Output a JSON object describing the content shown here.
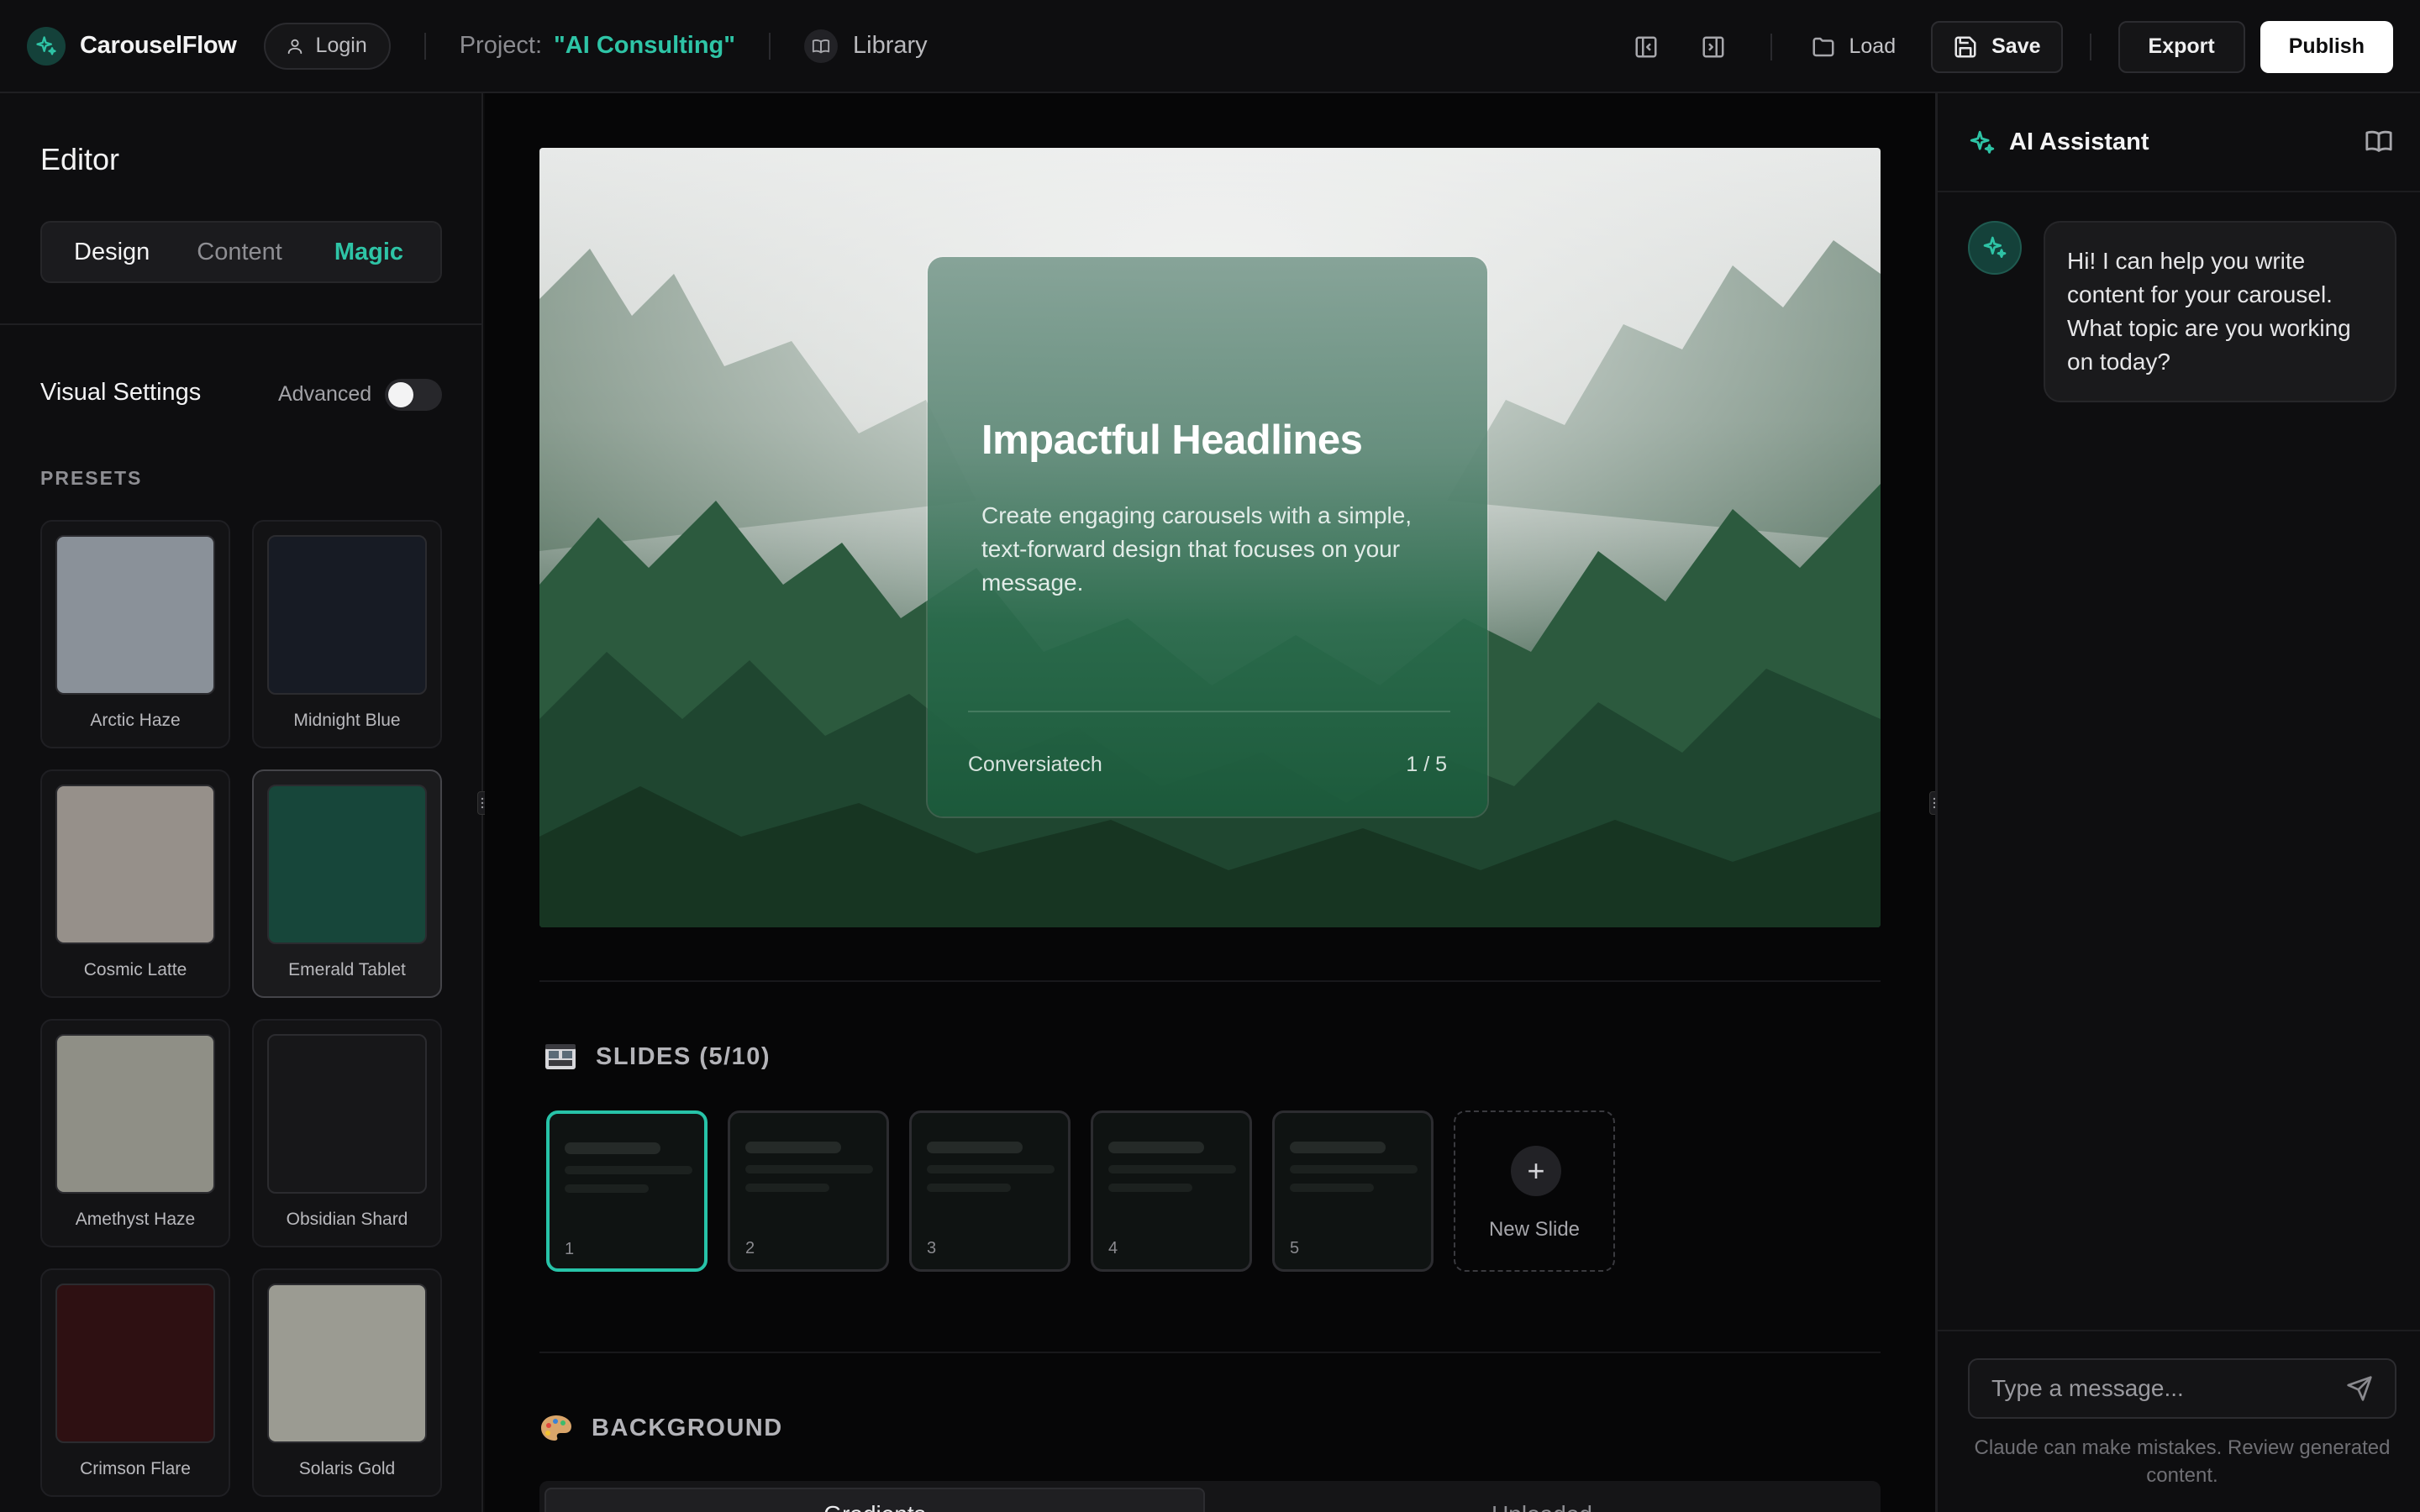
{
  "app": {
    "name": "CarouselFlow"
  },
  "topbar": {
    "login_label": "Login",
    "project_label": "Project:",
    "project_name": "\"AI Consulting\"",
    "library_label": "Library",
    "load_label": "Load",
    "save_label": "Save",
    "export_label": "Export",
    "publish_label": "Publish"
  },
  "editor": {
    "title": "Editor",
    "tabs": [
      {
        "label": "Design",
        "active": false
      },
      {
        "label": "Content",
        "active": false
      },
      {
        "label": "Magic",
        "active": true
      }
    ],
    "visual_settings_title": "Visual Settings",
    "advanced_label": "Advanced",
    "advanced_enabled": false,
    "presets_label": "PRESETS",
    "presets": [
      {
        "name": "Arctic Haze",
        "color": "#8a9199",
        "active": false
      },
      {
        "name": "Midnight Blue",
        "color": "#171b24",
        "active": false
      },
      {
        "name": "Cosmic Latte",
        "color": "#96908a",
        "active": false
      },
      {
        "name": "Emerald Tablet",
        "color": "#17463a",
        "active": true
      },
      {
        "name": "Amethyst Haze",
        "color": "#8f8f86",
        "active": false
      },
      {
        "name": "Obsidian Shard",
        "color": "#171719",
        "active": false
      },
      {
        "name": "Crimson Flare",
        "color": "#2e1012",
        "active": false
      },
      {
        "name": "Solaris Gold",
        "color": "#9b9b92",
        "active": false
      }
    ]
  },
  "slide": {
    "headline": "Impactful Headlines",
    "body": "Create engaging carousels with a simple, text-forward design that focuses on your message.",
    "brand": "Conversiatech",
    "page_indicator": "1 / 5"
  },
  "slides_section": {
    "title": "SLIDES (5/10)",
    "slides": [
      {
        "number": "1",
        "active": true
      },
      {
        "number": "2",
        "active": false
      },
      {
        "number": "3",
        "active": false
      },
      {
        "number": "4",
        "active": false
      },
      {
        "number": "5",
        "active": false
      }
    ],
    "new_slide_label": "New Slide"
  },
  "background_section": {
    "title": "BACKGROUND",
    "tabs": [
      {
        "label": "Gradients",
        "active": true
      },
      {
        "label": "Uploaded",
        "active": false
      }
    ]
  },
  "assistant": {
    "title": "AI Assistant",
    "greeting": "Hi! I can help you write content for your carousel. What topic are you working on today?",
    "input_placeholder": "Type a message...",
    "disclaimer": "Claude can make mistakes. Review generated content."
  },
  "colors": {
    "accent": "#2ec4a6",
    "background": "#0b0b0c",
    "panel": "#0e0e10"
  }
}
